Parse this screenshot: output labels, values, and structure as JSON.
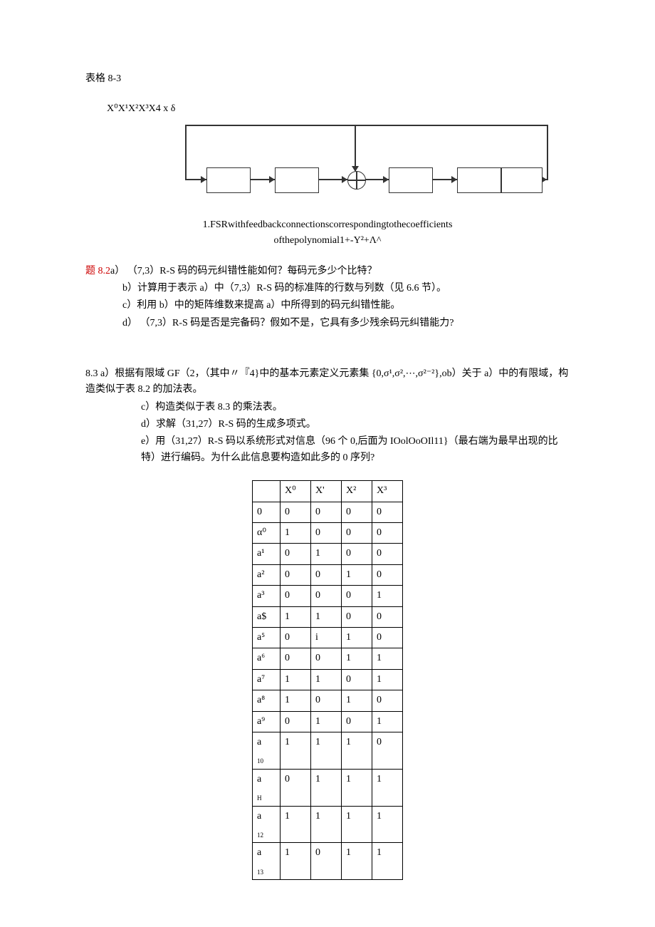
{
  "title": "表格 8-3",
  "polynomial": "X⁰X¹X²X³X4 x  δ",
  "caption_line1": "1.FSRwithfeedbackconnectionscorrespondingtothecoefficients",
  "caption_line2": "ofthepolynomial1+-Y²+Λ^",
  "q82_head": "题 8.2",
  "q82_a": "a） （7,3）R-S 码的码元纠错性能如何？每码元多少个比特？",
  "q82_b": "b）计算用于表示 a）中（7,3）R-S 码的标准阵的行数与列数（见 6.6 节）。",
  "q82_c": "c）利用 b）中的矩阵维数来提高 a）中所得到的码元纠错性能。",
  "q82_d": "d） （7,3）R-S 码是否是完备码？假如不是，它具有多少残余码元纠错能力?",
  "q83_a": "8.3  a）根据有限域 GF（2，（其中〃『4}中的基本元素定义元素集 {0,σ¹,σ²,⋯,σ²⁻²},ob）关于 a）中的有限域，构造类似于表 8.2 的加法表。",
  "q83_c": "c）构造类似于表 8.3 的乘法表。",
  "q83_d": "d）求解（31,27）R-S 码的生成多项式。",
  "q83_e": "e）用（31,27）R-S 码以系统形式对信息（96 个 0,后面为 IOolOoOIl11}（最右端为最早出现的比特）进行编码。为什么此信息要构造如此多的 0 序列?",
  "table": {
    "headers": [
      "",
      "X⁰",
      "X'",
      "X²",
      "X³"
    ],
    "rows": [
      [
        "0",
        "0",
        "0",
        "0",
        "0"
      ],
      [
        "α⁰",
        "1",
        "0",
        "0",
        "0"
      ],
      [
        "a¹",
        "0",
        "1",
        "0",
        "0"
      ],
      [
        "a²",
        "0",
        "0",
        "1",
        "0"
      ],
      [
        "a³",
        "0",
        "0",
        "0",
        "1"
      ],
      [
        "a$",
        "1",
        "1",
        "0",
        "0"
      ],
      [
        "a⁵",
        "0",
        "i",
        "1",
        "0"
      ],
      [
        "a⁶",
        "0",
        "0",
        "1",
        "1"
      ],
      [
        "a⁷",
        "1",
        "1",
        "0",
        "1"
      ],
      [
        "a⁸",
        "1",
        "0",
        "1",
        "0"
      ],
      [
        "a⁹",
        "0",
        "1",
        "0",
        "1"
      ],
      [
        "a\n10",
        "1",
        "1",
        "1",
        "0"
      ],
      [
        "a\nH",
        "0",
        "1",
        "1",
        "1"
      ],
      [
        "a\n12",
        "1",
        "1",
        "1",
        "1"
      ],
      [
        "a\n13",
        "1",
        "0",
        "1",
        "1"
      ]
    ]
  }
}
